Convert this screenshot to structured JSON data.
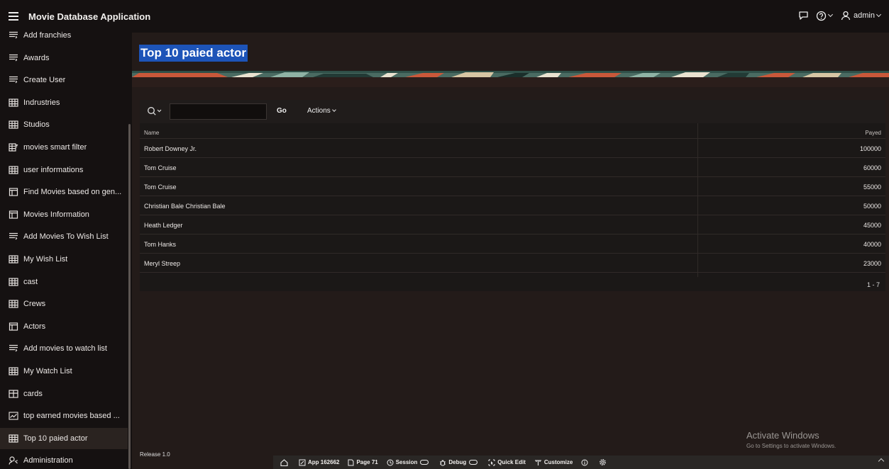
{
  "header": {
    "app_title": "Movie Database Application",
    "user": "admin"
  },
  "sidebar": {
    "items": [
      {
        "label": "Add franchies",
        "icon": "form-icon"
      },
      {
        "label": "Awards",
        "icon": "form-icon"
      },
      {
        "label": "Create User",
        "icon": "form-icon"
      },
      {
        "label": "Indrustries",
        "icon": "report-icon"
      },
      {
        "label": "Studios",
        "icon": "report-icon"
      },
      {
        "label": "movies smart filter",
        "icon": "smart-filter-icon"
      },
      {
        "label": "user informations",
        "icon": "report-icon"
      },
      {
        "label": "Find Movies based on gen...",
        "icon": "page-icon"
      },
      {
        "label": "Movies Information",
        "icon": "page-icon"
      },
      {
        "label": "Add Movies To Wish List",
        "icon": "form-icon"
      },
      {
        "label": "My Wish List",
        "icon": "report-icon"
      },
      {
        "label": "cast",
        "icon": "report-icon"
      },
      {
        "label": "Crews",
        "icon": "report-icon"
      },
      {
        "label": "Actors",
        "icon": "page-icon"
      },
      {
        "label": "Add movies to watch list",
        "icon": "form-icon"
      },
      {
        "label": "My Watch List",
        "icon": "report-icon"
      },
      {
        "label": "cards",
        "icon": "cards-icon"
      },
      {
        "label": "top earned movies based ...",
        "icon": "chart-icon"
      },
      {
        "label": "Top 10 paied actor",
        "icon": "report-icon"
      },
      {
        "label": "Administration",
        "icon": "admin-icon"
      }
    ]
  },
  "page": {
    "title": "Top 10 paied actor"
  },
  "report": {
    "search_placeholder": "",
    "go_label": "Go",
    "actions_label": "Actions",
    "columns": [
      "Name",
      "Payed"
    ],
    "rows": [
      {
        "name": "Robert Downey Jr.",
        "payed": "100000"
      },
      {
        "name": "Tom Cruise",
        "payed": "60000"
      },
      {
        "name": "Tom Cruise",
        "payed": "55000"
      },
      {
        "name": "Christian Bale Christian Bale",
        "payed": "50000"
      },
      {
        "name": "Heath Ledger",
        "payed": "45000"
      },
      {
        "name": "Tom Hanks",
        "payed": "40000"
      },
      {
        "name": "Meryl Streep",
        "payed": "23000"
      }
    ],
    "pagination": "1 - 7"
  },
  "footer": {
    "release": "Release 1.0"
  },
  "devbar": {
    "app": "App 162662",
    "page": "Page 71",
    "session": "Session",
    "debug": "Debug",
    "quick_edit": "Quick Edit",
    "customize": "Customize"
  },
  "watermark": {
    "line1": "Activate Windows",
    "line2": "Go to Settings to activate Windows."
  },
  "colors": {
    "background": "#231b19",
    "nav": "#151111",
    "title_highlight": "#1d54b8"
  }
}
